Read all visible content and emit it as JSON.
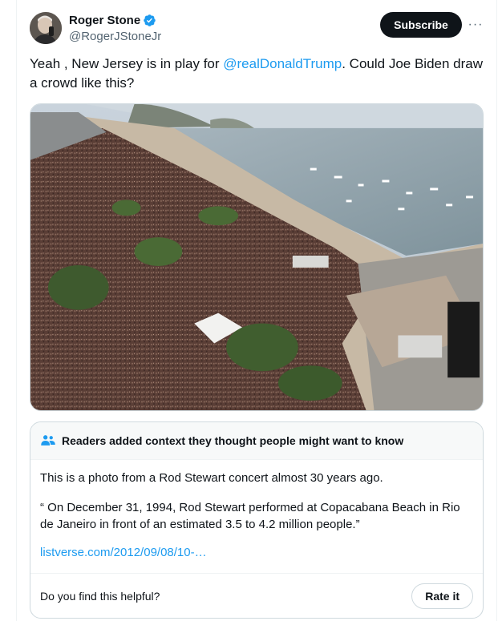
{
  "author": {
    "display_name": "Roger Stone",
    "handle": "@RogerJStoneJr",
    "avatar_icon": "profile-photo",
    "verified_icon": "verified-badge-icon"
  },
  "actions": {
    "subscribe_label": "Subscribe",
    "more_label": "···"
  },
  "tweet": {
    "text_before": "Yeah , New Jersey is in play for ",
    "mention": "@realDonaldTrump",
    "text_after": ". Could Joe Biden draw a crowd like this?"
  },
  "media": {
    "description_icon": "crowd-beach-photo"
  },
  "community_note": {
    "header": "Readers added context they thought people might want to know",
    "header_icon": "people-icon",
    "paragraph1": "This is a photo from a Rod Stewart concert almost 30 years ago.",
    "paragraph2": "“ On December 31, 1994, Rod Stewart performed at Copacabana Beach in Rio de Janeiro in front of an estimated 3.5 to 4.2 million people.”",
    "link": "listverse.com/2012/09/08/10-…",
    "helpful_question": "Do you find this helpful?",
    "rate_label": "Rate it"
  },
  "colors": {
    "accent": "#1d9bf0",
    "text": "#0f1419",
    "muted": "#536471",
    "border": "#cfd9de"
  }
}
